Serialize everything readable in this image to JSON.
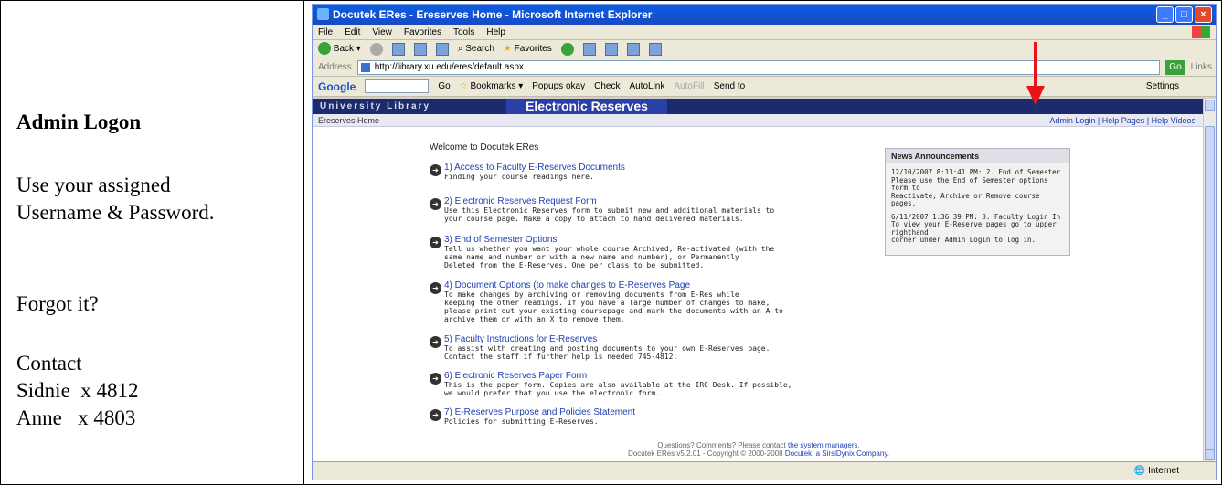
{
  "left": {
    "heading": "Admin Logon",
    "instruction_line1": "Use your assigned",
    "instruction_line2": "Username & Password.",
    "forgot": "Forgot it?",
    "contact": "Contact",
    "contact1": "Sidnie  x 4812",
    "contact2": "Anne   x 4803"
  },
  "browser": {
    "title": "Docutek ERes - Ereserves Home - Microsoft Internet Explorer",
    "menu": [
      "File",
      "Edit",
      "View",
      "Favorites",
      "Tools",
      "Help"
    ],
    "toolbar": {
      "back": "Back",
      "search": "Search",
      "favorites": "Favorites"
    },
    "address_label": "Address",
    "address_url": "http://library.xu.edu/eres/default.aspx",
    "go": "Go",
    "links": "Links",
    "google": {
      "logo": "Google",
      "go": "Go",
      "bookmarks": "Bookmarks",
      "popups": "Popups okay",
      "check": "Check",
      "autolink": "AutoLink",
      "autofill": "AutoFill",
      "sendto": "Send to",
      "settings": "Settings"
    },
    "status_zone": "Internet"
  },
  "page": {
    "banner_left": "University Library",
    "banner_title": "Electronic Reserves",
    "nav_home": "Ereserves Home",
    "nav_links": "Admin Login | Help Pages | Help Videos",
    "welcome": "Welcome to Docutek ERes",
    "items": [
      {
        "link": "1) Access to Faculty E-Reserves Documents",
        "d1": "Finding your course readings here.",
        "d2": "",
        "d3": "",
        "d4": ""
      },
      {
        "link": "2) Electronic Reserves Request Form",
        "d1": "Use this Electronic Reserves form to submit new and additional materials to",
        "d2": "your course page. Make a copy to attach to hand delivered materials.",
        "d3": "",
        "d4": ""
      },
      {
        "link": "3) End of Semester Options",
        "d1": "Tell us whether you want your whole course Archived, Re-activated (with the",
        "d2": "same name and number or with a new name and number), or Permanently",
        "d3": "Deleted from the E-Reserves. One per class to be submitted.",
        "d4": ""
      },
      {
        "link": "4) Document Options (to make changes to E-Reserves Page",
        "d1": "To make changes by archiving or removing documents from E-Res while",
        "d2": "keeping the other readings. If you have a large number of changes to make,",
        "d3": "please print out your existing coursepage and mark the documents with an A to",
        "d4": "archive them or with an X to remove them."
      },
      {
        "link": "5) Faculty Instructions for E-Reserves",
        "d1": "To assist with creating and posting documents to your own E-Reserves page.",
        "d2": "Contact the staff if further help is needed 745-4812.",
        "d3": "",
        "d4": ""
      },
      {
        "link": "6) Electronic Reserves Paper Form",
        "d1": "This is the paper form. Copies are also available at the IRC Desk. If possible,",
        "d2": "we would prefer that you use the electronic form.",
        "d3": "",
        "d4": ""
      },
      {
        "link": "7) E-Reserves Purpose and Policies Statement",
        "d1": "Policies for submitting E-Reserves.",
        "d2": "",
        "d3": "",
        "d4": ""
      }
    ],
    "news": {
      "title": "News Announcements",
      "e1a": "12/10/2007 8:13:41 PM: 2. End of Semester",
      "e1b": "Please use the End of Semester options form to",
      "e1c": "Reactivate, Archive or Remove course pages.",
      "e2a": "6/11/2007 1:36:39 PM: 3. Faculty Login In",
      "e2b": "To view your E-Reserve pages go to upper righthand",
      "e2c": "corner under Admin Login to log in."
    },
    "footer1_text": "Questions? Comments? Please contact",
    "footer1_link": "the system managers",
    "footer2_text": "Docutek ERes v5.2.01 - Copyright © 2000-2008",
    "footer2_link": "Docutek, a SirsiDynix Company"
  },
  "colors": {
    "arrow": "#e8141a",
    "banner": "#1c2a6e",
    "link": "#1f3fb0"
  }
}
